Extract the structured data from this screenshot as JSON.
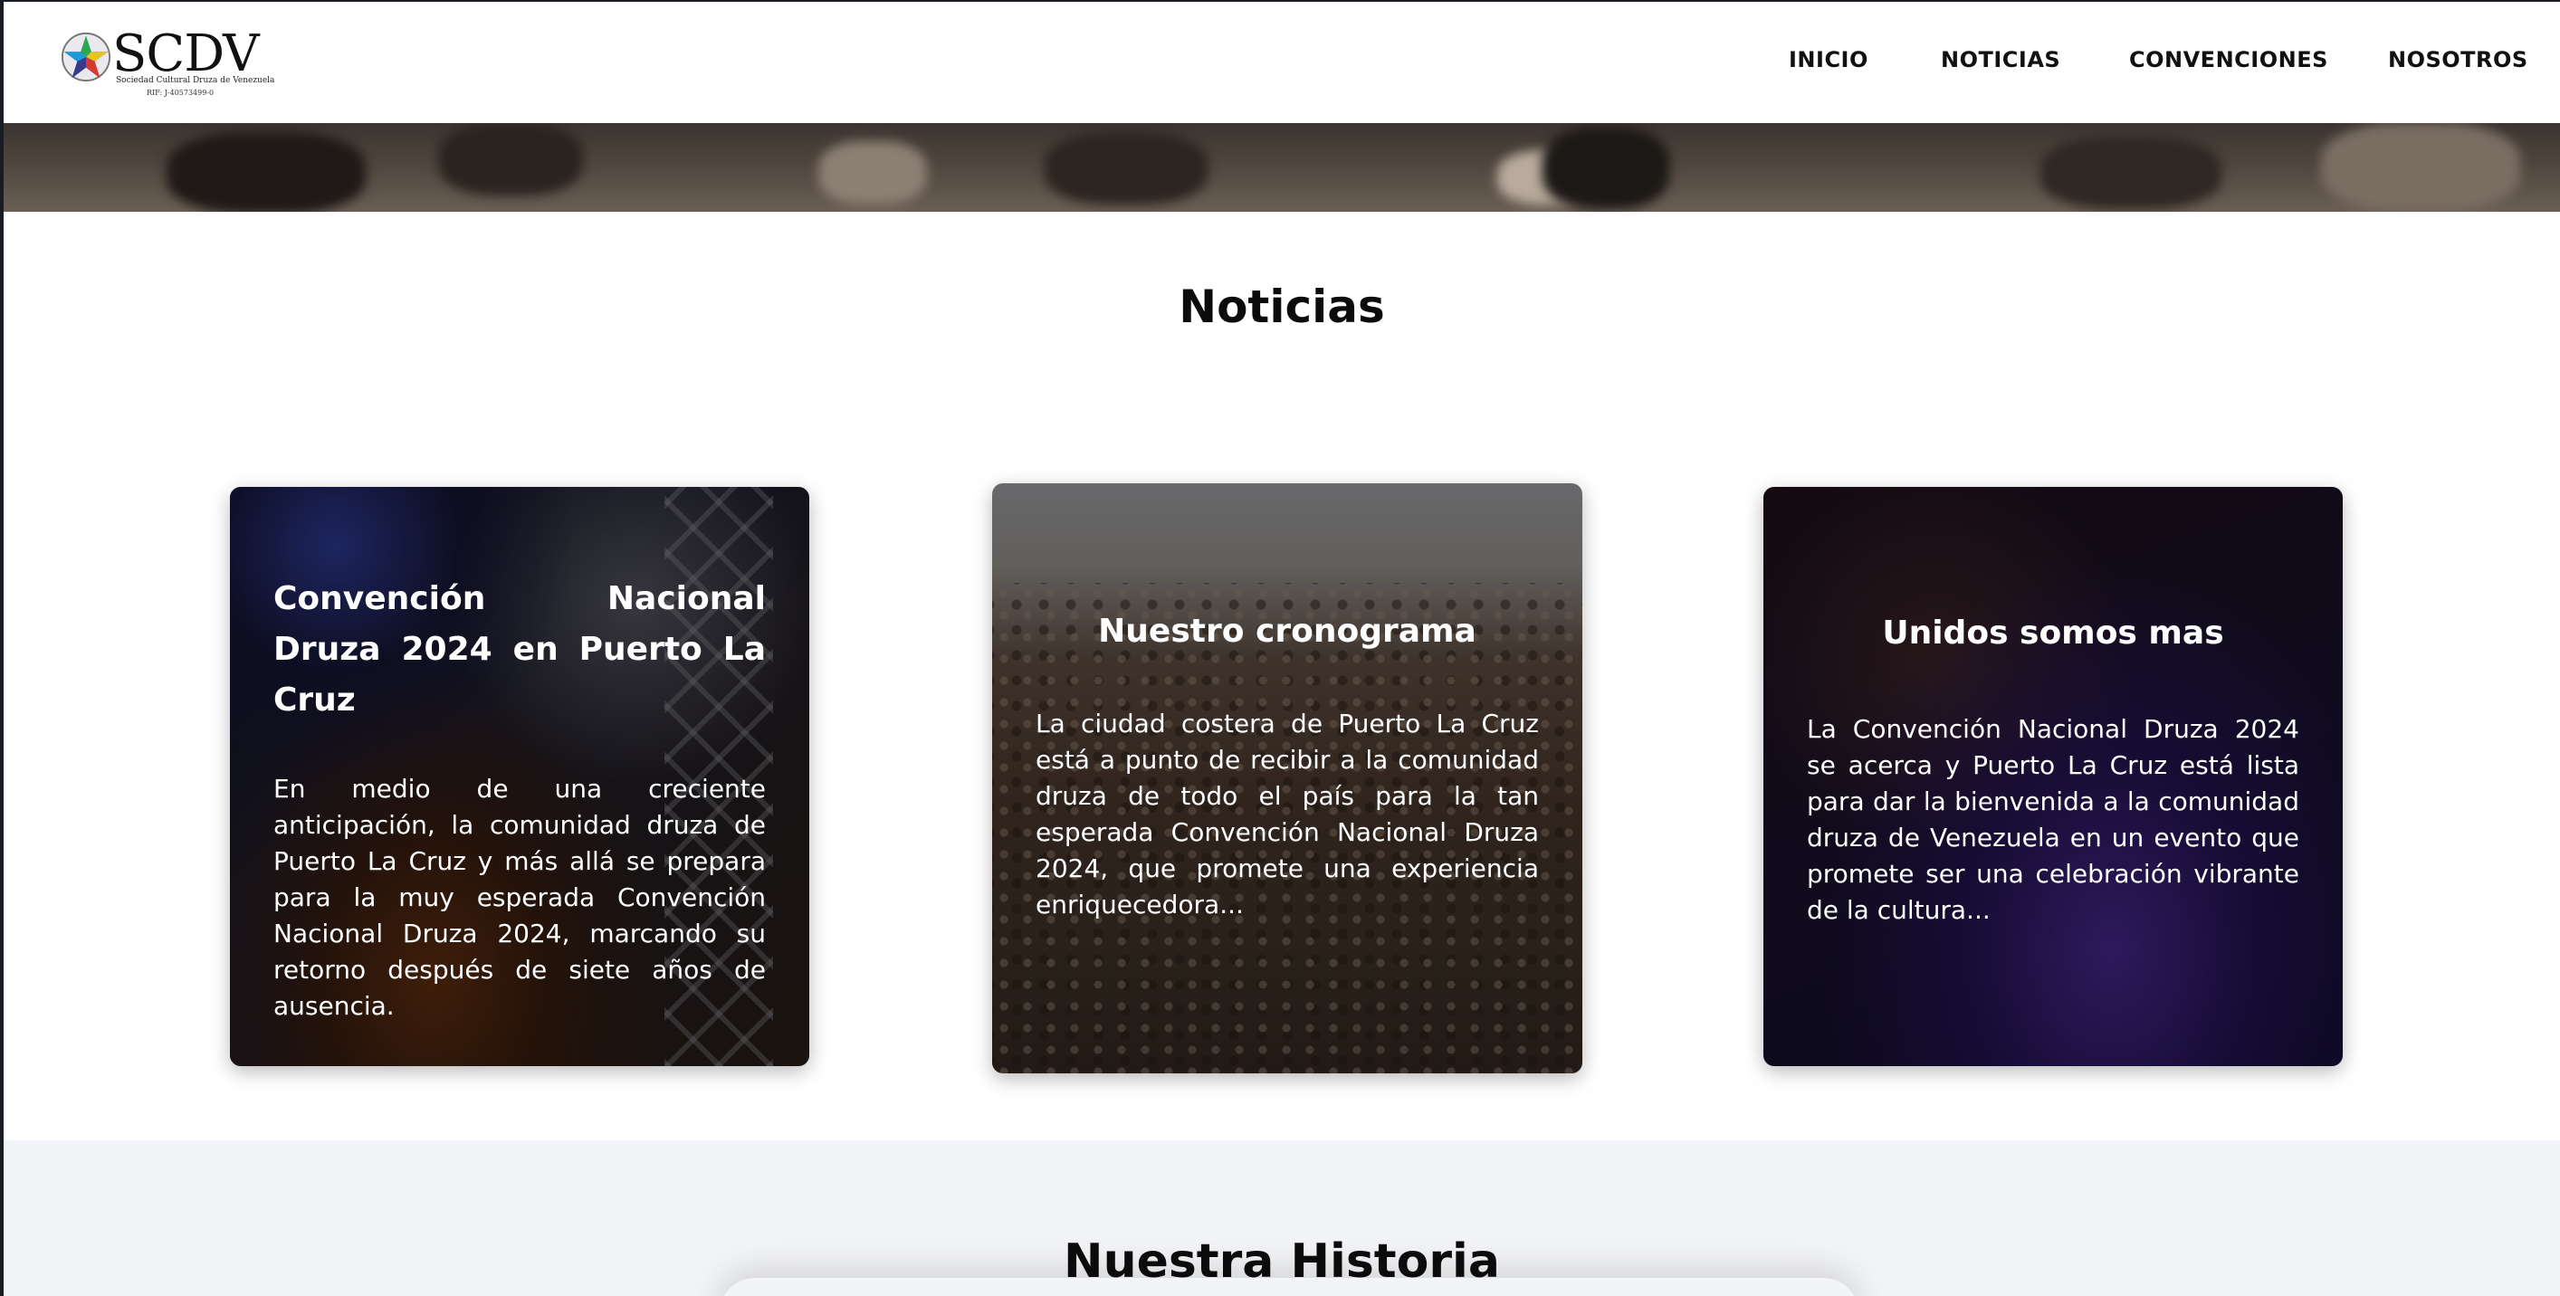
{
  "header": {
    "logo": {
      "text": "SCDV",
      "subtitle": "Sociedad Cultural Druza de Venezuela",
      "rif": "RIF: J-40573499-0"
    },
    "nav": [
      "INICIO",
      "NOTICIAS",
      "CONVENCIONES",
      "NOSOTROS"
    ]
  },
  "noticias": {
    "title": "Noticias",
    "cards": [
      {
        "title": "Convención Nacional Druza 2024 en Puerto La Cruz",
        "text": "En medio de una creciente anticipación, la comunidad druza de Puerto La Cruz y más allá se prepara para la muy esperada Convención Nacional Druza 2024, marcando su retorno después de siete años de ausencia."
      },
      {
        "title": "Nuestro cronograma",
        "text": "La ciudad costera de Puerto La Cruz está a punto de recibir a la comunidad druza de todo el país para la tan esperada Convención Nacional Druza 2024, que promete una experiencia enriquecedora..."
      },
      {
        "title": "Unidos somos mas",
        "text": "La Convención Nacional Druza 2024 se acerca y Puerto La Cruz está lista para dar la bienvenida a la comunidad druza de Venezuela en un evento que promete ser una celebración vibrante de la cultura..."
      }
    ]
  },
  "historia": {
    "title": "Nuestra Historia"
  },
  "colors": {
    "background": "#ffffff",
    "section_alt": "#f3f4f7",
    "text": "#0b0b0b",
    "card_text": "#ffffff"
  }
}
